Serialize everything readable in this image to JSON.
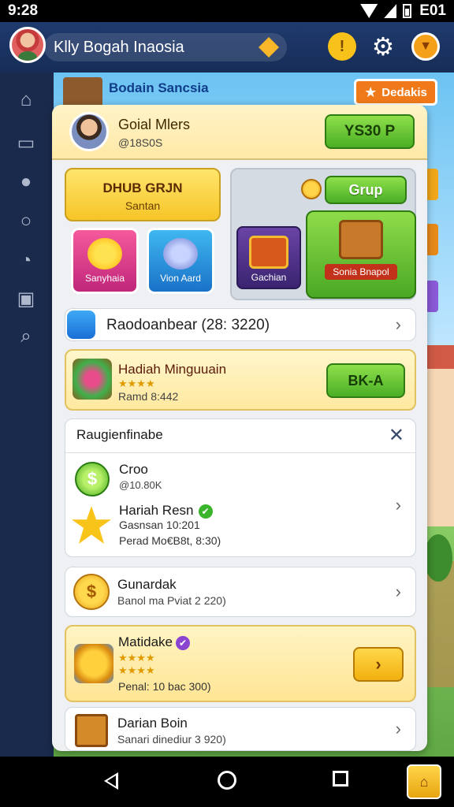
{
  "status_bar": {
    "time": "9:28",
    "right": "E01"
  },
  "header": {
    "player_name": "Klly Bogah Inaosia",
    "btn1_glyph": "!",
    "btn2_glyph": "⚙",
    "btn3_glyph": "▼"
  },
  "sidebar": {
    "icons": [
      "home-icon",
      "inbox-icon",
      "people-icon",
      "chat-icon",
      "headset-icon",
      "mail-icon",
      "search-icon"
    ]
  },
  "scene": {
    "label": "Bodain Sancsia",
    "chip_label": "Dedakis"
  },
  "panel": {
    "title": "Goial Mlers",
    "subtitle": "@18S0S",
    "header_button": "YS30 P",
    "group1": {
      "title": "DHUB GRJN",
      "subtitle": "Santan"
    },
    "tile1": "Sanyhaia",
    "tile2": "Vion Aard",
    "group2_button": "Grup",
    "tile3": "Gachian",
    "tile4": "Sonia Bnapol",
    "row1": "Raodoanbear (28: 3220)",
    "row2": {
      "title": "Hadiah Minguuain",
      "stars": "★★★★",
      "subtitle": "Ramd 8:442",
      "button": "BK-A"
    },
    "card": {
      "header": "Raugienfinabe",
      "close": "✕",
      "item1_title": "Croo",
      "item1_sub": "@10.80K",
      "item1_glyph": "$",
      "item2_title": "Hariah Resn",
      "item2_badge": "✔",
      "item2_line1": "Gasnsan 10:201",
      "item2_line2": "Perad Mo€B8t, 8:30)"
    },
    "row3": {
      "title": "Gunardak",
      "subtitle": "Banol ma Pviat 2 220)",
      "glyph": "$"
    },
    "row4": {
      "title": "Matidake",
      "badge": "✔",
      "stars1": "★★★★",
      "stars2": "★★★★",
      "subtitle": "Penal: 10 bac 300)",
      "button": "›"
    },
    "row5": {
      "title": "Darian Boin",
      "subtitle": "Sanari dinediur 3 920)"
    }
  },
  "chevron": "›",
  "navbar": {
    "special_glyph": "⌂"
  }
}
